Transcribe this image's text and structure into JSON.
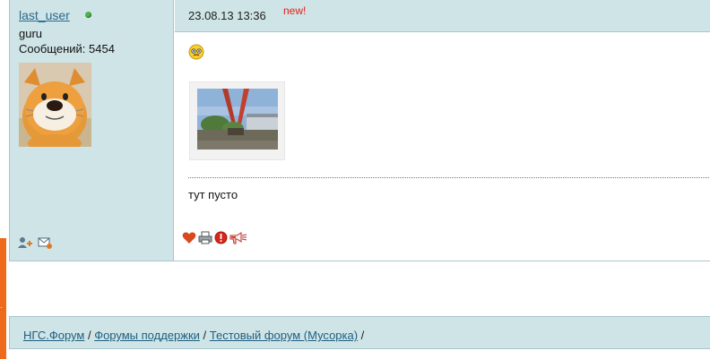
{
  "author": {
    "name": "last_user",
    "online": true,
    "rank": "guru",
    "posts_label": "Сообщений: 5454",
    "colors": {
      "online": "#4fb34a",
      "link": "#2a6b8c"
    }
  },
  "post": {
    "date": "23.08.13 13:36",
    "new_label": "new!",
    "text": "тут пусто",
    "icons": [
      "smiley-icon",
      "image-thumbnail",
      "like-heart-icon",
      "print-icon",
      "report-icon",
      "quote-icon"
    ]
  },
  "breadcrumb": {
    "items": [
      "НГС.Форум",
      "Форумы поддержки",
      "Тестовый форум (Мусорка)"
    ],
    "separator": " / "
  },
  "colors": {
    "panel_bg": "#cfe4e6",
    "border": "#a9c7cc",
    "accent_tab": "#ee6a1a",
    "new_badge": "#e02020"
  }
}
